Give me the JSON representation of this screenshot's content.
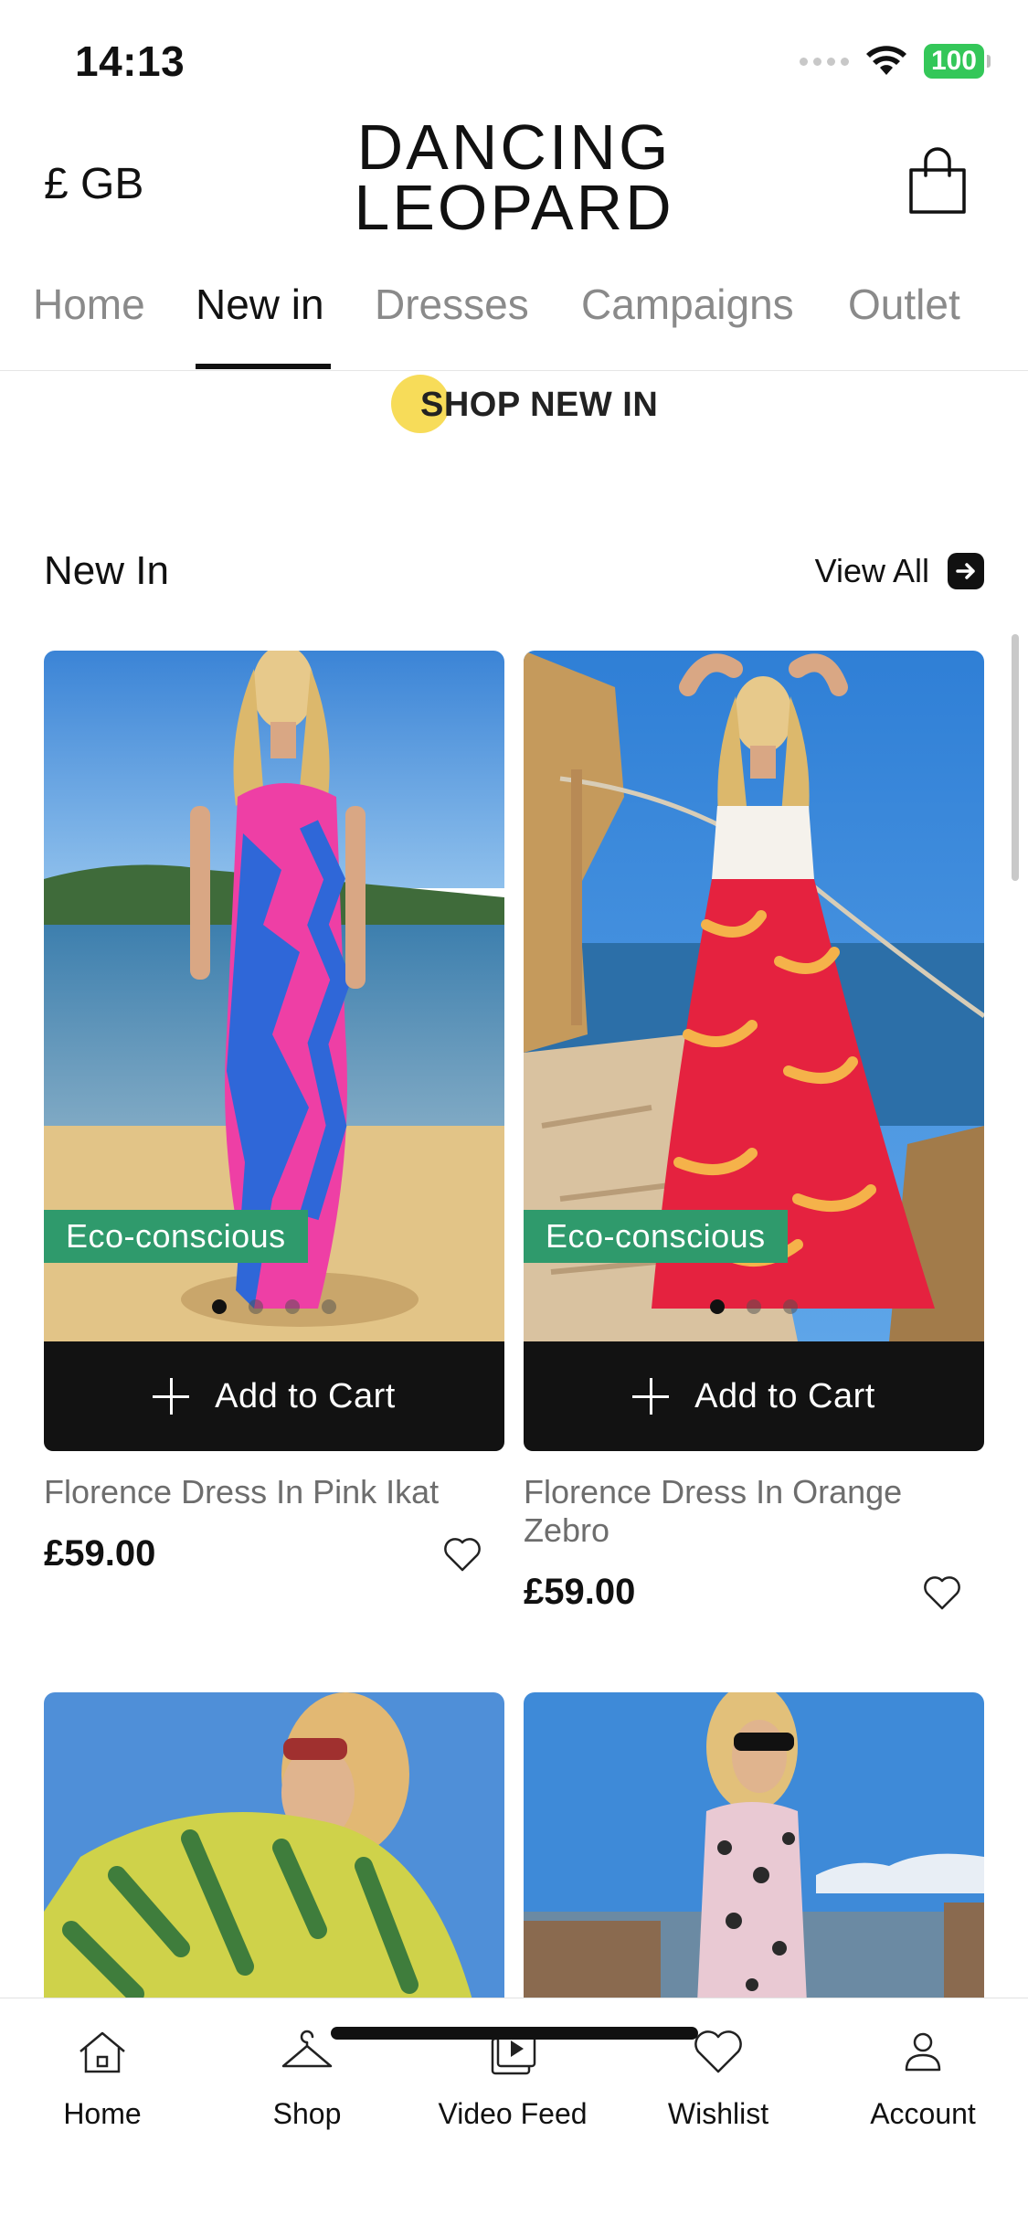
{
  "status_bar": {
    "time": "14:13",
    "battery": "100"
  },
  "header": {
    "currency": "£ GB",
    "logo_line1": "DANCING",
    "logo_line2": "LEOPARD"
  },
  "nav": {
    "tabs": [
      {
        "label": "Home"
      },
      {
        "label": "New in"
      },
      {
        "label": "Dresses"
      },
      {
        "label": "Campaigns"
      },
      {
        "label": "Outlet"
      }
    ],
    "active": "New in"
  },
  "banner": {
    "text": "SHOP NEW IN"
  },
  "section": {
    "title": "New In",
    "view_all": "View All"
  },
  "products": [
    {
      "name": "Florence Dress In Pink Ikat",
      "price": "£59.00",
      "badge": "Eco-conscious",
      "button": "Add to Cart",
      "image_dots": 4,
      "active_dot": 1
    },
    {
      "name": "Florence Dress In Orange Zebro",
      "price": "£59.00",
      "badge": "Eco-conscious",
      "button": "Add to Cart",
      "image_dots": 3,
      "active_dot": 1
    }
  ],
  "bottom_tabs": [
    {
      "label": "Home",
      "icon": "home-icon"
    },
    {
      "label": "Shop",
      "icon": "hanger-icon"
    },
    {
      "label": "Video Feed",
      "icon": "video-feed-icon"
    },
    {
      "label": "Wishlist",
      "icon": "heart-icon"
    },
    {
      "label": "Account",
      "icon": "person-icon"
    }
  ],
  "colors": {
    "eco_badge": "#2f9a6c",
    "add_to_cart_bg": "#121212",
    "banner_dot": "#f7dc59",
    "battery": "#34c759"
  }
}
